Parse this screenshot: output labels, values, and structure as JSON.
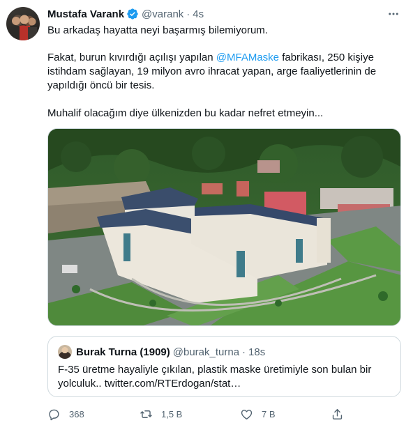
{
  "tweet": {
    "author_name": "Mustafa Varank",
    "handle": "@varank",
    "separator": "·",
    "time": "4s",
    "line1": "Bu arkadaş hayatta neyi başarmış bilemiyorum.",
    "para2_before": "Fakat, burun kıvırdığı açılışı yapılan ",
    "para2_mention": "@MFAMaske",
    "para2_after": " fabrikası, 250 kişiye istihdam sağlayan, 19 milyon avro ihracat yapan, arge faaliyetlerinin de yapıldığı öncü bir tesis.",
    "line3": "Muhalif olacağım diye ülkenizden bu kadar nefret etmeyin..."
  },
  "quoted": {
    "author_name": "Burak Turna (1909)",
    "handle": "@burak_turna",
    "separator": "·",
    "time": "18s",
    "text": "F-35 üretme hayaliyle çıkılan, plastik maske üretimiyle son bulan bir yolculuk.. twitter.com/RTErdogan/stat…"
  },
  "actions": {
    "replies": "368",
    "retweets": "1,5 B",
    "likes": "7 B"
  },
  "colors": {
    "accent": "#1d9bf0",
    "secondary_text": "#536471",
    "border": "#cfd9de"
  },
  "icons": [
    "verified-badge-icon",
    "more-icon",
    "reply-icon",
    "retweet-icon",
    "like-icon",
    "share-icon"
  ]
}
